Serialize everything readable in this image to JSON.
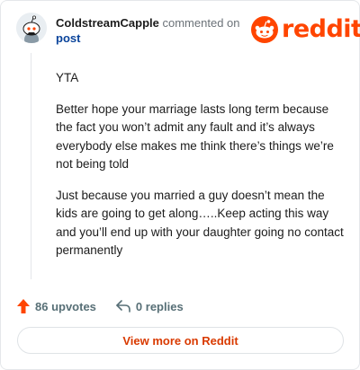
{
  "comment": {
    "username": "ColdstreamCapple",
    "action_text": "commented on",
    "post_link": "post",
    "paragraphs": [
      "YTA",
      "Better hope your marriage lasts long term because the fact you won’t admit any fault and it’s always everybody else makes me think there’s things we’re not being told",
      "Just because you married a guy doesn’t mean the kids are going to get along…..Keep acting this way and you’ll end up with your daughter going no contact permanently"
    ]
  },
  "brand": {
    "wordmark": "reddit",
    "color": "#ff4500",
    "icon": "reddit-snoo-icon"
  },
  "actions": {
    "upvotes": "86 upvotes",
    "replies": "0 replies",
    "upvote_icon": "upvote-arrow-icon",
    "reply_icon": "reply-arrow-icon"
  },
  "footer": {
    "view_more": "View more on Reddit",
    "link_color": "#d93a00"
  }
}
